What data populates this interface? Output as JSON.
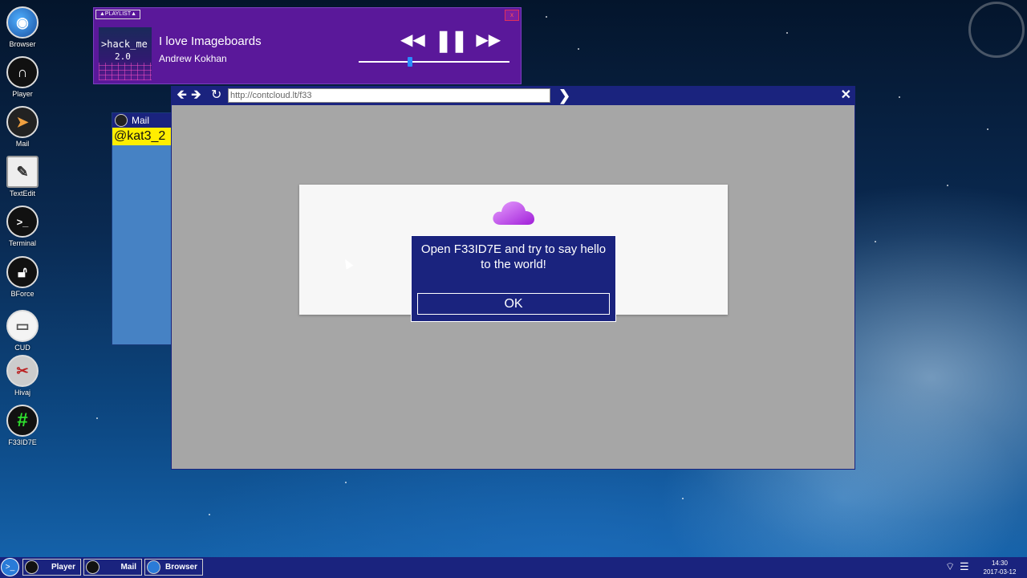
{
  "desktop_icons": [
    {
      "label": "Browser",
      "icon": "globe-icon"
    },
    {
      "label": "Player",
      "icon": "headphones-icon"
    },
    {
      "label": "Mail",
      "icon": "paper-plane-icon"
    },
    {
      "label": "TextEdit",
      "icon": "notepad-icon"
    },
    {
      "label": "Terminal",
      "icon": "terminal-icon",
      "glyph": ">_"
    },
    {
      "label": "BForce",
      "icon": "padlock-icon"
    },
    {
      "label": "CUD",
      "icon": "drive-icon"
    },
    {
      "label": "Hivaj",
      "icon": "hijack-icon"
    },
    {
      "label": "F33ID7E",
      "icon": "hash-icon",
      "glyph": "#"
    }
  ],
  "player": {
    "playlist_label": "▲PLAYLIST▲",
    "close_label": "x",
    "album": {
      "line1": ">hack_me",
      "line2": "2.0"
    },
    "title": "I love Imageboards",
    "artist": "Andrew Kokhan",
    "controls": {
      "rewind": "◀◀",
      "pause": "❚❚",
      "forward": "▶▶"
    },
    "progress": 0.34
  },
  "mail": {
    "title": "Mail",
    "user": "@kat3_2"
  },
  "browser": {
    "back": "🡸",
    "forward": "🡺",
    "reload": "↻",
    "url": "http://contcloud.lt/f33",
    "go": "❯",
    "close": "✕"
  },
  "dialog": {
    "message": "Open F33ID7E and try to say hello to the world!",
    "ok_label": "OK"
  },
  "taskbar": {
    "start_label": ">_",
    "tasks": [
      {
        "label": "Player",
        "icon": "headphones-icon"
      },
      {
        "label": "Mail",
        "icon": "paper-plane-icon"
      },
      {
        "label": "Browser",
        "icon": "globe-icon"
      }
    ],
    "wifi": "⌔",
    "menu": "☰",
    "time": "14:30",
    "date": "2017-03-12"
  },
  "colors": {
    "accent": "#1a237e",
    "player_bg": "#5a189a",
    "mail_bg": "#4682c4",
    "highlight": "#ffee00"
  }
}
